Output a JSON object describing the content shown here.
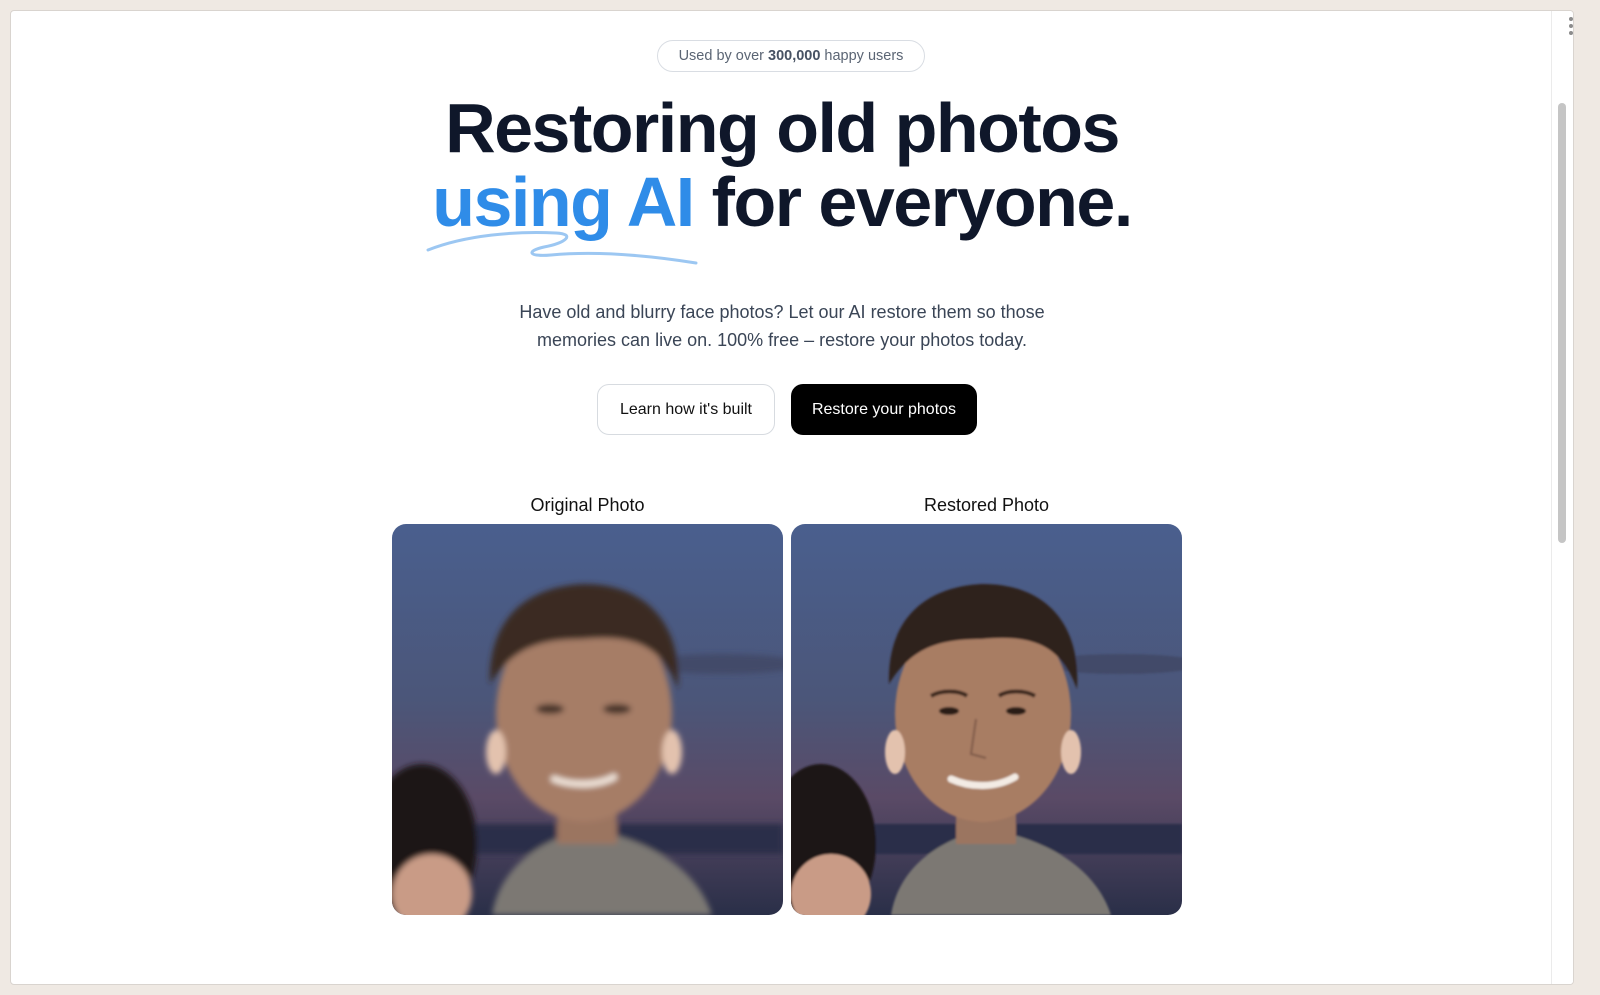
{
  "badge": {
    "prefix": "Used by over",
    "count": "300,000",
    "suffix": "happy users"
  },
  "hero": {
    "line1": "Restoring old photos",
    "accent": "using AI",
    "line2_rest": "for everyone."
  },
  "subtitle": "Have old and blurry face photos? Let our AI restore them so those memories can live on. 100% free – restore your photos today.",
  "buttons": {
    "learn": "Learn how it's built",
    "restore": "Restore your photos"
  },
  "photos": {
    "original_label": "Original Photo",
    "restored_label": "Restored Photo"
  },
  "colors": {
    "accent": "#2f8ce8",
    "heading": "#0f172a",
    "primary_button": "#000000"
  }
}
